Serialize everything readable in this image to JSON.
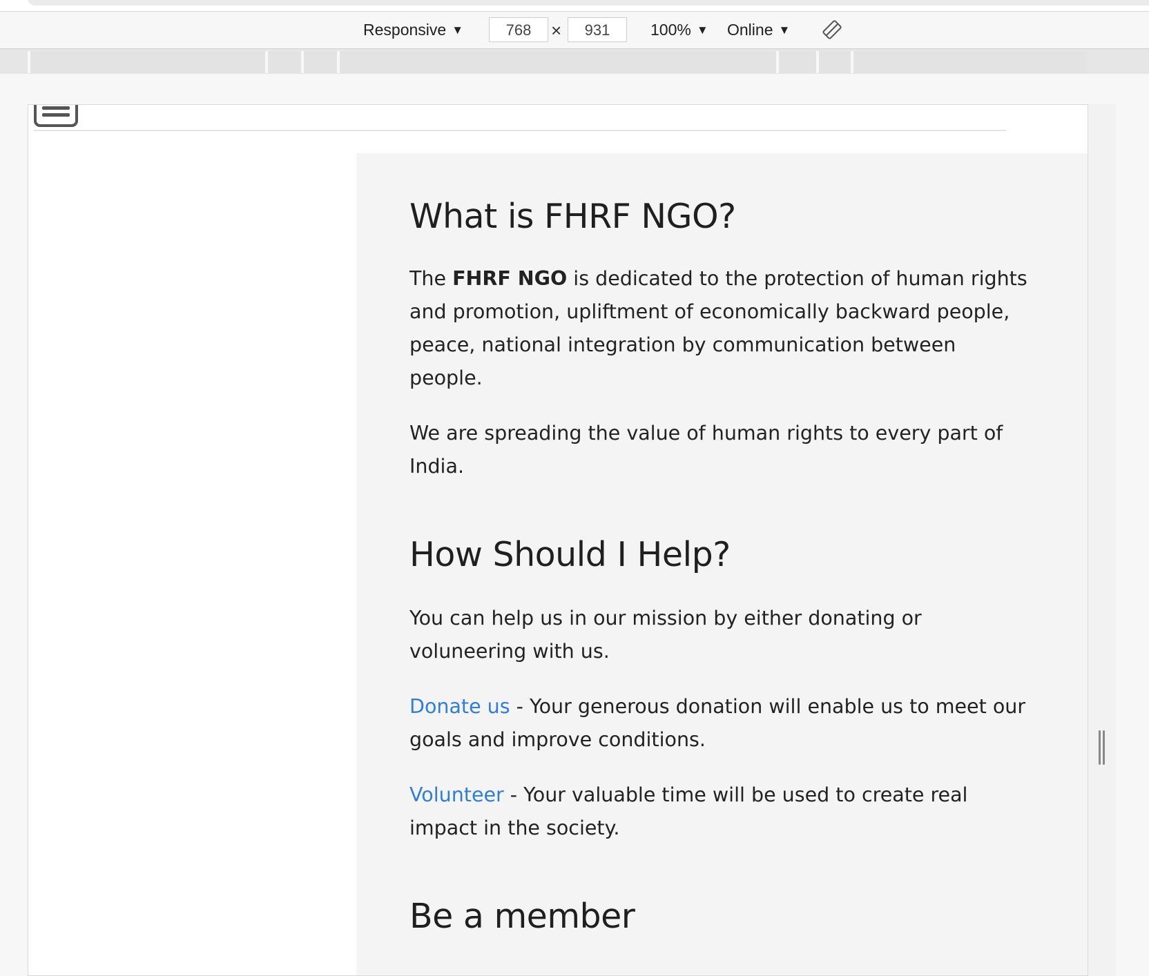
{
  "device_toolbar": {
    "device_label": "Responsive",
    "width_value": "768",
    "height_value": "931",
    "times_symbol": "×",
    "zoom_label": "100%",
    "network_label": "Online",
    "caret": "▼"
  },
  "page": {
    "section1": {
      "heading": "What is FHRF NGO?",
      "p1_prefix": "The ",
      "p1_bold": "FHRF NGO",
      "p1_suffix": " is dedicated to the protection of human rights and promotion, upliftment of economically backward people, peace, national integration by communication between people.",
      "p2": "We are spreading the value of human rights to every part of India."
    },
    "section2": {
      "heading": "How Should I Help?",
      "intro": "You can help us in our mission by either donating or voluneering with us.",
      "donate_link": "Donate us",
      "donate_text": " - Your generous donation will enable us to meet our goals and improve conditions.",
      "volunteer_link": "Volunteer",
      "volunteer_text": " - Your valuable time will be used to create real impact in the society."
    },
    "section3": {
      "heading": "Be a member"
    }
  },
  "colors": {
    "link": "#2f7de1",
    "panel_bg": "#f4f4f4",
    "text": "#1f1f1f"
  }
}
